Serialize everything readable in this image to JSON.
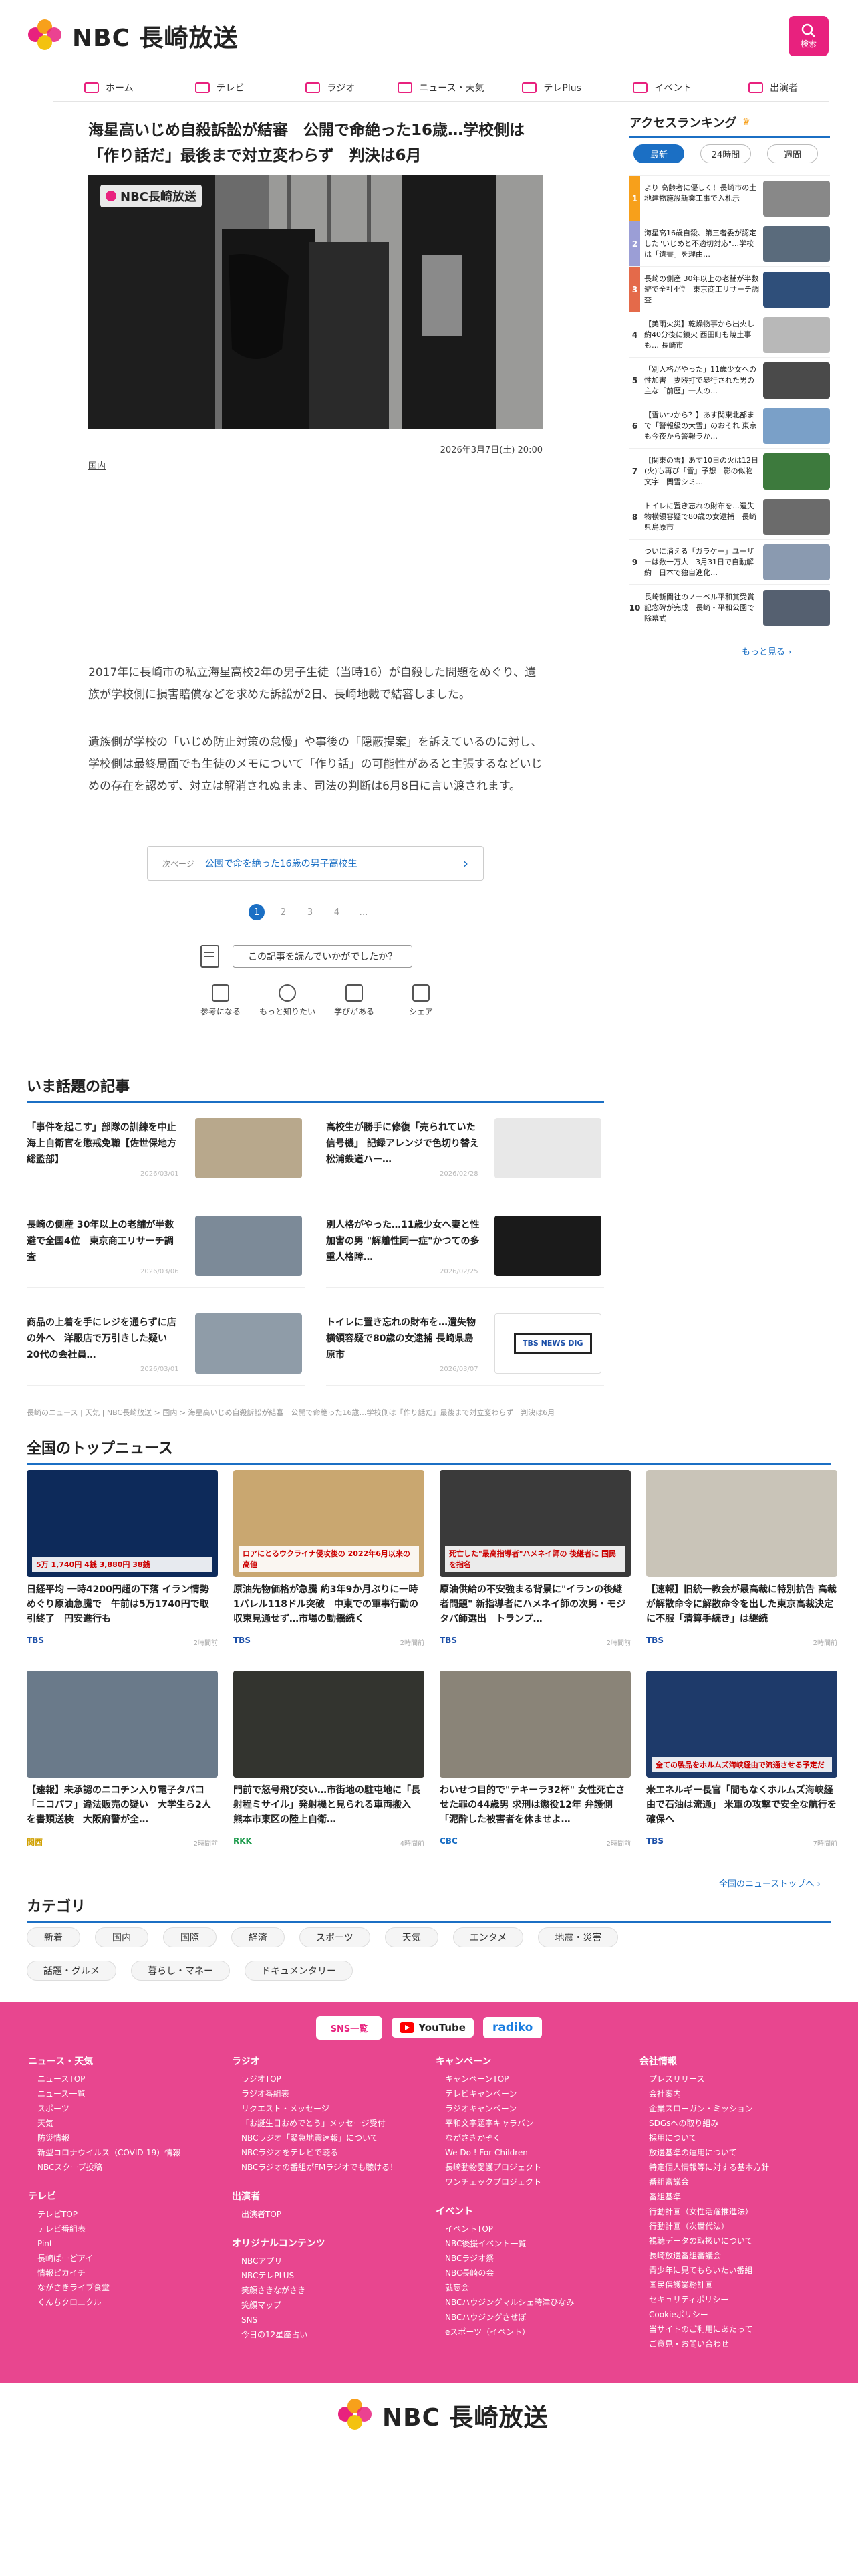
{
  "site": {
    "brand": "NBC 長崎放送",
    "search_label": "検索"
  },
  "nav": [
    {
      "label": "ホーム",
      "icon": "home-icon"
    },
    {
      "label": "テレビ",
      "icon": "tv-icon"
    },
    {
      "label": "ラジオ",
      "icon": "radio-icon"
    },
    {
      "label": "ニュース・天気",
      "icon": "news-icon"
    },
    {
      "label": "テレPlus",
      "icon": "play-icon"
    },
    {
      "label": "イベント",
      "icon": "calendar-icon"
    },
    {
      "label": "出演者",
      "icon": "people-icon"
    }
  ],
  "article": {
    "title": "海星高いじめ自殺訴訟が結審　公開で命絶った16歳…学校側は「作り話だ」最後まで対立変わらず　判決は6月",
    "photo_logo": "NBC長崎放送",
    "date": "2026年3月7日(土) 20:00",
    "category": "国内",
    "p1": "2017年に長崎市の私立海星高校2年の男子生徒（当時16）が自殺した問題をめぐり、遺族が学校側に損害賠償などを求めた訴訟が2日、長崎地裁で結審しました。",
    "p2": "遺族側が学校の「いじめ防止対策の怠慢」や事後の「隠蔽提案」を訴えているのに対し、学校側は最終局面でも生徒のメモについて「作り話」の可能性があると主張するなどいじめの存在を認めず、対立は解消されぬまま、司法の判断は6月8日に言い渡されます。",
    "next_label": "次ページ",
    "next_text": "公園で命を絶った16歳の男子高校生",
    "pages": [
      "1",
      "2",
      "3",
      "4",
      "…"
    ],
    "feedback_q": "この記事を読んでいかがでしたか？",
    "reactions": [
      {
        "label": "参考になる",
        "icon": "bulb-icon"
      },
      {
        "label": "もっと知りたい",
        "icon": "magnifier-icon"
      },
      {
        "label": "学びがある",
        "icon": "book-icon"
      },
      {
        "label": "シェア",
        "icon": "share-icon"
      }
    ]
  },
  "ranking": {
    "title": "アクセスランキング",
    "tabs": [
      "最新",
      "24時間",
      "週間"
    ],
    "more": "もっと見る",
    "items": [
      {
        "n": "1",
        "text": "より 高齢者に優しく！長崎市の土地建物施設新業工事で入札示"
      },
      {
        "n": "2",
        "text": "海星高16歳自殺、第三者委が認定した\"いじめと不適切対応\"…学校は「遺書」を理由…"
      },
      {
        "n": "3",
        "text": "長崎の側産 30年以上の老舗が半数避で全社4位　東京商工リサーチ調査"
      },
      {
        "n": "4",
        "text": "【美雨火災】乾燥物事から出火し約40分後に鎮火 西田町も焼土事も… 長崎市"
      },
      {
        "n": "5",
        "text": "「別人格がやった」11歳少女への性加害　妻殴打で暴行された男の主な「前歴」一人の…"
      },
      {
        "n": "6",
        "text": "【雪いつから？】あす関東北部まで「警報級の大雪」のおそれ 東京も今夜から警報ラか…"
      },
      {
        "n": "7",
        "text": "【関東の雪】あす10日の火は12日(火)も再び「雪」予想　影の似物文字　関雪シミ…"
      },
      {
        "n": "8",
        "text": "トイレに置き忘れの財布を…遺失物横領容疑で80歳の女逮捕　長崎県島原市"
      },
      {
        "n": "9",
        "text": "ついに消える「ガラケー」ユーザーは数十万人　3月31日で自動解約　日本で独自進化…"
      },
      {
        "n": "10",
        "text": "長崎新聞社のノーベル平和賞受賞記念碑が完成　長崎・平和公園で除幕式"
      }
    ]
  },
  "topics": {
    "title": "いま話題の記事",
    "items": [
      {
        "text": "「事件を起こす」部隊の訓練を中止 海上自衛官を懲戒免職【佐世保地方総監部】",
        "date": "2026/03/01"
      },
      {
        "text": "高校生が勝手に修復「売られていた信号機」 記録アレンジで色切り替え　松浦鉄道ハー…",
        "date": "2026/02/28"
      },
      {
        "text": "長崎の側産 30年以上の老舗が半数避で全国4位　東京商工リサーチ調査",
        "date": "2026/03/06"
      },
      {
        "text": "別人格がやった…11歳少女へ妻と性加害の男 \"解離性同一症\"かつての多重人格障…",
        "date": "2026/02/25"
      },
      {
        "text": "商品の上着を手にレジを通らずに店の外へ　洋服店で万引きした疑い　20代の会社員…",
        "date": "2026/03/01"
      },
      {
        "text": "トイレに置き忘れの財布を…遺失物横領容疑で80歳の女逮捕 長崎県島原市",
        "date": "2026/03/07"
      }
    ],
    "breadcrumb": "長崎のニュース | 天気 | NBC長崎放送 > 国内 > 海星高いじめ自殺訴訟が結審　公開で命絶った16歳…学校側は「作り話だ」最後まで対立変わらず　判決は6月"
  },
  "topnews": {
    "title": "全国のトップニュース",
    "more": "全国のニューストップへ",
    "items": [
      {
        "text": "日経平均 一時4200円超の下落 イラン情勢めぐり原油急騰で　午前は5万1740円で取引終了　円安進行も",
        "src": "TBS",
        "time": "2時間前",
        "caption": "5万 1,740円 4銭 3,880円 38銭"
      },
      {
        "text": "原油先物価格が急騰 約3年9か月ぶりに一時1バレル118ドル突破　中東での軍事行動の収束見通せず…市場の動揺続く",
        "src": "TBS",
        "time": "2時間前",
        "caption": "ロアにとるウクライナ侵攻後の 2022年6月以来の高値"
      },
      {
        "text": "原油供給の不安強まる背景に\"イランの後継者問題\" 新指導者にハメネイ師の次男・モジタバ師選出　トランプ…",
        "src": "TBS",
        "time": "2時間前",
        "caption": "死亡した\"最高指導者\"ハメネイ師の 後継者に 国民を指名"
      },
      {
        "text": "【速報】旧統一教会が最高裁に特別抗告 高裁が解散命令に解散命令を出した東京高裁決定に不服「清算手続き」は継続",
        "src": "TBS",
        "time": "2時間前",
        "caption": ""
      },
      {
        "text": "【速報】未承認のニコチン入り電子タバコ「ニコパフ」違法販売の疑い　大学生ら2人を書類送検　大阪府警が全…",
        "src": "関西",
        "time": "2時間前",
        "caption": ""
      },
      {
        "text": "門前で怒号飛び交い…市街地の駐屯地に「長射程ミサイル」発射機と見られる車両搬入　熊本市東区の陸上自衛…",
        "src": "RKK",
        "time": "4時間前",
        "caption": ""
      },
      {
        "text": "わいせつ目的で\"テキーラ32杯\" 女性死亡させた罪の44歳男 求刑は懲役12年 弁護側「泥酔した被害者を休ませよ…",
        "src": "CBC",
        "time": "2時間前",
        "caption": ""
      },
      {
        "text": "米エネルギー長官「間もなくホルムズ海峡経由で石油は流通」 米軍の攻撃で安全な航行を確保へ",
        "src": "TBS",
        "time": "7時間前",
        "caption": "全ての製品をホルムズ海峡経由で流通させる予定だ"
      }
    ]
  },
  "categories": {
    "title": "カテゴリ",
    "items": [
      "新着",
      "国内",
      "国際",
      "経済",
      "スポーツ",
      "天気",
      "エンタメ",
      "地震・災害",
      "話題・グルメ",
      "暮らし・マネー",
      "ドキュメンタリー"
    ]
  },
  "footer": {
    "sns": "SNS一覧",
    "youtube": "YouTube",
    "radiko": "radiko",
    "cols": [
      [
        {
          "h": "ニュース・天気",
          "items": [
            "ニュースTOP",
            "ニュース一覧",
            "スポーツ",
            "天気",
            "防災情報",
            "新型コロナウイルス（COVID-19）情報",
            "NBCスクープ投稿"
          ]
        },
        {
          "h": "テレビ",
          "items": [
            "テレビTOP",
            "テレビ番組表",
            "Pint",
            "長崎ばーどアイ",
            "情報ピカイチ",
            "ながさきライブ食堂",
            "くんちクロニクル"
          ]
        }
      ],
      [
        {
          "h": "ラジオ",
          "items": [
            "ラジオTOP",
            "ラジオ番組表",
            "リクエスト・メッセージ",
            "「お誕生日おめでとう」メッセージ受付",
            "NBCラジオ「緊急地震速報」について",
            "NBCラジオをテレビで聴る",
            "NBCラジオの番組がFMラジオでも聴ける！"
          ]
        },
        {
          "h": "出演者",
          "items": [
            "出演者TOP"
          ]
        },
        {
          "h": "オリジナルコンテンツ",
          "items": [
            "NBCアプリ",
            "NBCテレPLUS",
            "笑顔さきながさき",
            "笑顔マップ",
            "SNS",
            "今日の12星座占い"
          ]
        }
      ],
      [
        {
          "h": "キャンペーン",
          "items": [
            "キャンペーンTOP",
            "テレビキャンペーン",
            "ラジオキャンペーン",
            "平和文字題字キャラバン",
            "ながさきかぞく",
            "We Do ! For Children",
            "長崎動物愛護プロジェクト",
            "ワンチェックプロジェクト"
          ]
        },
        {
          "h": "イベント",
          "items": [
            "イベントTOP",
            "NBC後援イベント一覧",
            "NBCラジオ祭",
            "NBC長崎の会",
            "就忘会",
            "NBCハウジングマルシェ時津ひなみ",
            "NBCハウジングさせぼ",
            "eスポーツ（イベント）"
          ]
        }
      ],
      [
        {
          "h": "会社情報",
          "items": [
            "プレスリリース",
            "会社案内",
            "企業スローガン・ミッション",
            "SDGsへの取り組み",
            "採用について",
            "放送基準の運用について",
            "特定個人情報等に対する基本方針",
            "番組審議会",
            "番組基準",
            "行動計画（女性活躍推進法）",
            "行動計画（次世代法）",
            "視聴データの取扱いについて",
            "長崎放送番組審議会",
            "青少年に見てもらいたい番組",
            "国民保護業務計画",
            "セキュリティポリシー",
            "Cookieポリシー",
            "当サイトのご利用にあたって",
            "ご意見・お問い合わせ"
          ]
        }
      ]
    ],
    "brand": "NBC 長崎放送"
  }
}
